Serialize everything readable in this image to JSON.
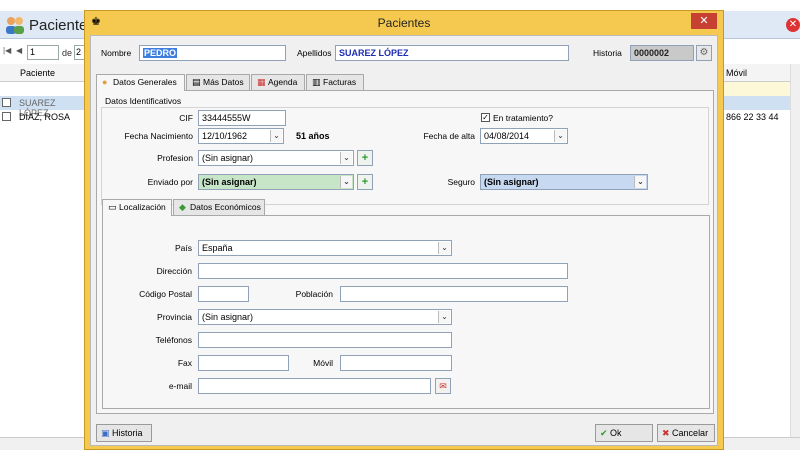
{
  "background": {
    "title": "Pacientes",
    "pager": {
      "first": "|◀",
      "prev": "◀",
      "page": "1",
      "of_label": "de",
      "total": "2"
    },
    "grid": {
      "col_patient": "Paciente",
      "col_mobile": "Móvil",
      "rows": [
        {
          "name": "SUAREZ LÓPEZ,",
          "mobile": ""
        },
        {
          "name": "DÍAZ, ROSA",
          "mobile": "866 22 33 44"
        }
      ]
    }
  },
  "dialog": {
    "title": "Pacientes",
    "header": {
      "nombre_label": "Nombre",
      "nombre_value": "PEDRO",
      "apellidos_label": "Apellidos",
      "apellidos_value": "SUAREZ LÓPEZ",
      "historia_label": "Historia",
      "historia_value": "0000002"
    },
    "tabs": [
      {
        "label": "Datos Generales",
        "icon": "user-icon"
      },
      {
        "label": "Más Datos",
        "icon": "notes-icon"
      },
      {
        "label": "Agenda",
        "icon": "calendar-icon"
      },
      {
        "label": "Facturas",
        "icon": "invoice-icon"
      }
    ],
    "identificativos": {
      "group_title": "Datos Identificativos",
      "cif_label": "CIF",
      "cif_value": "33444555W",
      "en_tratamiento_label": "En tratamiento?",
      "en_tratamiento_checked": true,
      "fecha_nac_label": "Fecha Nacimiento",
      "fecha_nac_value": "12/10/1962",
      "edad": "51 años",
      "fecha_alta_label": "Fecha de alta",
      "fecha_alta_value": "04/08/2014",
      "profesion_label": "Profesion",
      "profesion_value": "(Sin asignar)",
      "enviado_label": "Enviado por",
      "enviado_value": "(Sin asignar)",
      "seguro_label": "Seguro",
      "seguro_value": "(Sin asignar)"
    },
    "subtabs": [
      {
        "label": "Localización",
        "icon": "card-icon"
      },
      {
        "label": "Datos Económicos",
        "icon": "money-icon"
      }
    ],
    "localizacion": {
      "pais_label": "País",
      "pais_value": "España",
      "direccion_label": "Dirección",
      "direccion_value": "",
      "cp_label": "Código Postal",
      "cp_value": "",
      "poblacion_label": "Población",
      "poblacion_value": "",
      "provincia_label": "Provincia",
      "provincia_value": "(Sin asignar)",
      "telefonos_label": "Teléfonos",
      "telefonos_value": "",
      "fax_label": "Fax",
      "fax_value": "",
      "movil_label": "Móvil",
      "movil_value": "",
      "email_label": "e-mail",
      "email_value": ""
    },
    "footer": {
      "historia_button": "Historia",
      "ok_button": "Ok",
      "cancel_button": "Cancelar"
    }
  },
  "colors": {
    "dialog_frame": "#f5c94f",
    "close_red": "#c84031",
    "field_text_blue": "#1d2eb3",
    "enviado_green": "#c7e5c7",
    "seguro_blue": "#c7d8f1"
  }
}
